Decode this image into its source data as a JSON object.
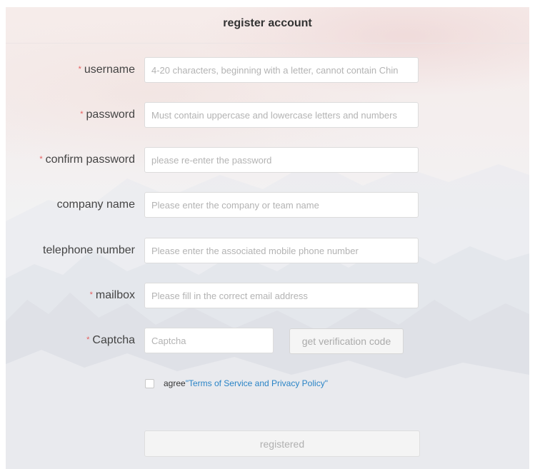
{
  "header": {
    "title": "register account"
  },
  "fields": {
    "username": {
      "required_mark": "*",
      "label": "username",
      "placeholder": "4-20 characters, beginning with a letter, cannot contain Chin",
      "value": ""
    },
    "password": {
      "required_mark": "*",
      "label": "password",
      "placeholder": "Must contain uppercase and lowercase letters and numbers",
      "value": ""
    },
    "confirm_password": {
      "required_mark": "*",
      "label": "confirm password",
      "placeholder": "please re-enter the password",
      "value": ""
    },
    "company_name": {
      "label": "company name",
      "placeholder": "Please enter the company or team name",
      "value": ""
    },
    "telephone_number": {
      "label": "telephone number",
      "placeholder": "Please enter the associated mobile phone number",
      "value": ""
    },
    "mailbox": {
      "required_mark": "*",
      "label": "mailbox",
      "placeholder": "Please fill in the correct email address",
      "value": ""
    },
    "captcha": {
      "required_mark": "*",
      "label": "Captcha",
      "placeholder": "Captcha",
      "value": ""
    }
  },
  "captcha_button": {
    "label": "get verification code"
  },
  "agreement": {
    "checked": false,
    "prefix": "agree",
    "link_text": "\"Terms of Service and Privacy Policy\""
  },
  "submit": {
    "label": "registered"
  },
  "colors": {
    "required_mark": "#e65b5b",
    "link": "#2a84c6",
    "title": "#333333"
  }
}
